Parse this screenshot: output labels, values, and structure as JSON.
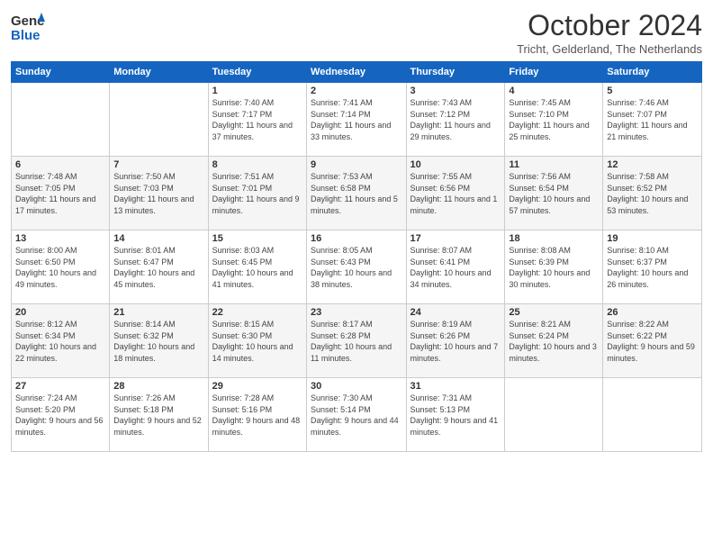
{
  "header": {
    "logo_line1": "General",
    "logo_line2": "Blue",
    "month": "October 2024",
    "location": "Tricht, Gelderland, The Netherlands"
  },
  "days_of_week": [
    "Sunday",
    "Monday",
    "Tuesday",
    "Wednesday",
    "Thursday",
    "Friday",
    "Saturday"
  ],
  "weeks": [
    [
      {
        "day": "",
        "sunrise": "",
        "sunset": "",
        "daylight": ""
      },
      {
        "day": "",
        "sunrise": "",
        "sunset": "",
        "daylight": ""
      },
      {
        "day": "1",
        "sunrise": "Sunrise: 7:40 AM",
        "sunset": "Sunset: 7:17 PM",
        "daylight": "Daylight: 11 hours and 37 minutes."
      },
      {
        "day": "2",
        "sunrise": "Sunrise: 7:41 AM",
        "sunset": "Sunset: 7:14 PM",
        "daylight": "Daylight: 11 hours and 33 minutes."
      },
      {
        "day": "3",
        "sunrise": "Sunrise: 7:43 AM",
        "sunset": "Sunset: 7:12 PM",
        "daylight": "Daylight: 11 hours and 29 minutes."
      },
      {
        "day": "4",
        "sunrise": "Sunrise: 7:45 AM",
        "sunset": "Sunset: 7:10 PM",
        "daylight": "Daylight: 11 hours and 25 minutes."
      },
      {
        "day": "5",
        "sunrise": "Sunrise: 7:46 AM",
        "sunset": "Sunset: 7:07 PM",
        "daylight": "Daylight: 11 hours and 21 minutes."
      }
    ],
    [
      {
        "day": "6",
        "sunrise": "Sunrise: 7:48 AM",
        "sunset": "Sunset: 7:05 PM",
        "daylight": "Daylight: 11 hours and 17 minutes."
      },
      {
        "day": "7",
        "sunrise": "Sunrise: 7:50 AM",
        "sunset": "Sunset: 7:03 PM",
        "daylight": "Daylight: 11 hours and 13 minutes."
      },
      {
        "day": "8",
        "sunrise": "Sunrise: 7:51 AM",
        "sunset": "Sunset: 7:01 PM",
        "daylight": "Daylight: 11 hours and 9 minutes."
      },
      {
        "day": "9",
        "sunrise": "Sunrise: 7:53 AM",
        "sunset": "Sunset: 6:58 PM",
        "daylight": "Daylight: 11 hours and 5 minutes."
      },
      {
        "day": "10",
        "sunrise": "Sunrise: 7:55 AM",
        "sunset": "Sunset: 6:56 PM",
        "daylight": "Daylight: 11 hours and 1 minute."
      },
      {
        "day": "11",
        "sunrise": "Sunrise: 7:56 AM",
        "sunset": "Sunset: 6:54 PM",
        "daylight": "Daylight: 10 hours and 57 minutes."
      },
      {
        "day": "12",
        "sunrise": "Sunrise: 7:58 AM",
        "sunset": "Sunset: 6:52 PM",
        "daylight": "Daylight: 10 hours and 53 minutes."
      }
    ],
    [
      {
        "day": "13",
        "sunrise": "Sunrise: 8:00 AM",
        "sunset": "Sunset: 6:50 PM",
        "daylight": "Daylight: 10 hours and 49 minutes."
      },
      {
        "day": "14",
        "sunrise": "Sunrise: 8:01 AM",
        "sunset": "Sunset: 6:47 PM",
        "daylight": "Daylight: 10 hours and 45 minutes."
      },
      {
        "day": "15",
        "sunrise": "Sunrise: 8:03 AM",
        "sunset": "Sunset: 6:45 PM",
        "daylight": "Daylight: 10 hours and 41 minutes."
      },
      {
        "day": "16",
        "sunrise": "Sunrise: 8:05 AM",
        "sunset": "Sunset: 6:43 PM",
        "daylight": "Daylight: 10 hours and 38 minutes."
      },
      {
        "day": "17",
        "sunrise": "Sunrise: 8:07 AM",
        "sunset": "Sunset: 6:41 PM",
        "daylight": "Daylight: 10 hours and 34 minutes."
      },
      {
        "day": "18",
        "sunrise": "Sunrise: 8:08 AM",
        "sunset": "Sunset: 6:39 PM",
        "daylight": "Daylight: 10 hours and 30 minutes."
      },
      {
        "day": "19",
        "sunrise": "Sunrise: 8:10 AM",
        "sunset": "Sunset: 6:37 PM",
        "daylight": "Daylight: 10 hours and 26 minutes."
      }
    ],
    [
      {
        "day": "20",
        "sunrise": "Sunrise: 8:12 AM",
        "sunset": "Sunset: 6:34 PM",
        "daylight": "Daylight: 10 hours and 22 minutes."
      },
      {
        "day": "21",
        "sunrise": "Sunrise: 8:14 AM",
        "sunset": "Sunset: 6:32 PM",
        "daylight": "Daylight: 10 hours and 18 minutes."
      },
      {
        "day": "22",
        "sunrise": "Sunrise: 8:15 AM",
        "sunset": "Sunset: 6:30 PM",
        "daylight": "Daylight: 10 hours and 14 minutes."
      },
      {
        "day": "23",
        "sunrise": "Sunrise: 8:17 AM",
        "sunset": "Sunset: 6:28 PM",
        "daylight": "Daylight: 10 hours and 11 minutes."
      },
      {
        "day": "24",
        "sunrise": "Sunrise: 8:19 AM",
        "sunset": "Sunset: 6:26 PM",
        "daylight": "Daylight: 10 hours and 7 minutes."
      },
      {
        "day": "25",
        "sunrise": "Sunrise: 8:21 AM",
        "sunset": "Sunset: 6:24 PM",
        "daylight": "Daylight: 10 hours and 3 minutes."
      },
      {
        "day": "26",
        "sunrise": "Sunrise: 8:22 AM",
        "sunset": "Sunset: 6:22 PM",
        "daylight": "Daylight: 9 hours and 59 minutes."
      }
    ],
    [
      {
        "day": "27",
        "sunrise": "Sunrise: 7:24 AM",
        "sunset": "Sunset: 5:20 PM",
        "daylight": "Daylight: 9 hours and 56 minutes."
      },
      {
        "day": "28",
        "sunrise": "Sunrise: 7:26 AM",
        "sunset": "Sunset: 5:18 PM",
        "daylight": "Daylight: 9 hours and 52 minutes."
      },
      {
        "day": "29",
        "sunrise": "Sunrise: 7:28 AM",
        "sunset": "Sunset: 5:16 PM",
        "daylight": "Daylight: 9 hours and 48 minutes."
      },
      {
        "day": "30",
        "sunrise": "Sunrise: 7:30 AM",
        "sunset": "Sunset: 5:14 PM",
        "daylight": "Daylight: 9 hours and 44 minutes."
      },
      {
        "day": "31",
        "sunrise": "Sunrise: 7:31 AM",
        "sunset": "Sunset: 5:13 PM",
        "daylight": "Daylight: 9 hours and 41 minutes."
      },
      {
        "day": "",
        "sunrise": "",
        "sunset": "",
        "daylight": ""
      },
      {
        "day": "",
        "sunrise": "",
        "sunset": "",
        "daylight": ""
      }
    ]
  ]
}
